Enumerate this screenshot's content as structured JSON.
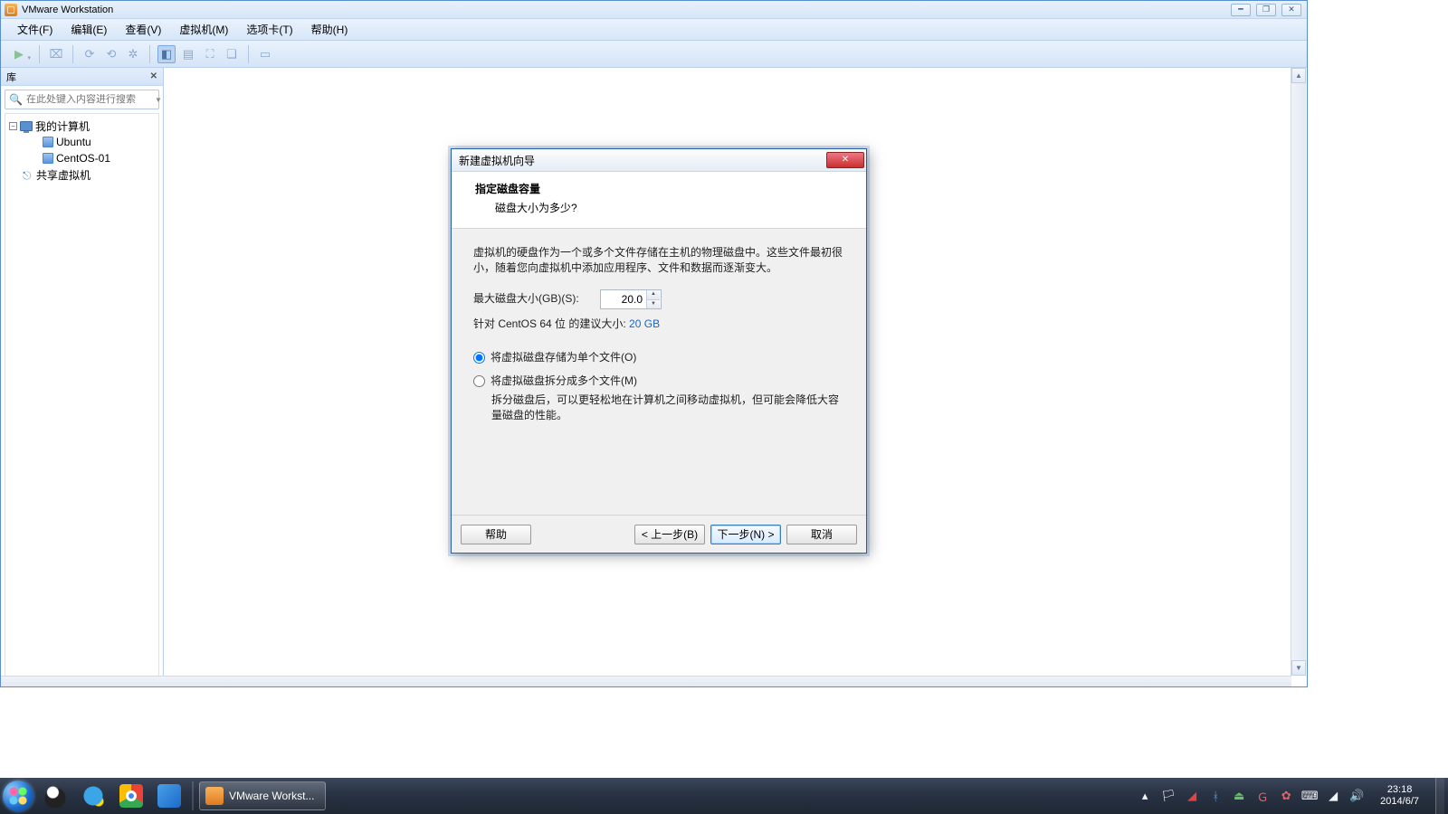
{
  "app": {
    "title": "VMware Workstation",
    "menu": [
      "文件(F)",
      "编辑(E)",
      "查看(V)",
      "虚拟机(M)",
      "选项卡(T)",
      "帮助(H)"
    ]
  },
  "sidebar": {
    "header": "库",
    "search_placeholder": "在此处键入内容进行搜索",
    "nodes": {
      "root": "我的计算机",
      "children": [
        "Ubuntu",
        "CentOS-01"
      ],
      "shared": "共享虚拟机"
    }
  },
  "dialog": {
    "title": "新建虚拟机向导",
    "h1": "指定磁盘容量",
    "h2": "磁盘大小为多少?",
    "intro": "虚拟机的硬盘作为一个或多个文件存储在主机的物理磁盘中。这些文件最初很小，随着您向虚拟机中添加应用程序、文件和数据而逐渐变大。",
    "size_label": "最大磁盘大小(GB)(S):",
    "size_value": "20.0",
    "recommend_prefix": "针对 CentOS 64 位 的建议大小: ",
    "recommend_value": "20 GB",
    "radio_single": "将虚拟磁盘存储为单个文件(O)",
    "radio_split": "将虚拟磁盘拆分成多个文件(M)",
    "split_note": "拆分磁盘后，可以更轻松地在计算机之间移动虚拟机，但可能会降低大容量磁盘的性能。",
    "btn_help": "帮助",
    "btn_back": "< 上一步(B)",
    "btn_next": "下一步(N) >",
    "btn_cancel": "取消"
  },
  "taskbar": {
    "active": "VMware Workst...",
    "time": "23:18",
    "date": "2014/6/7"
  }
}
